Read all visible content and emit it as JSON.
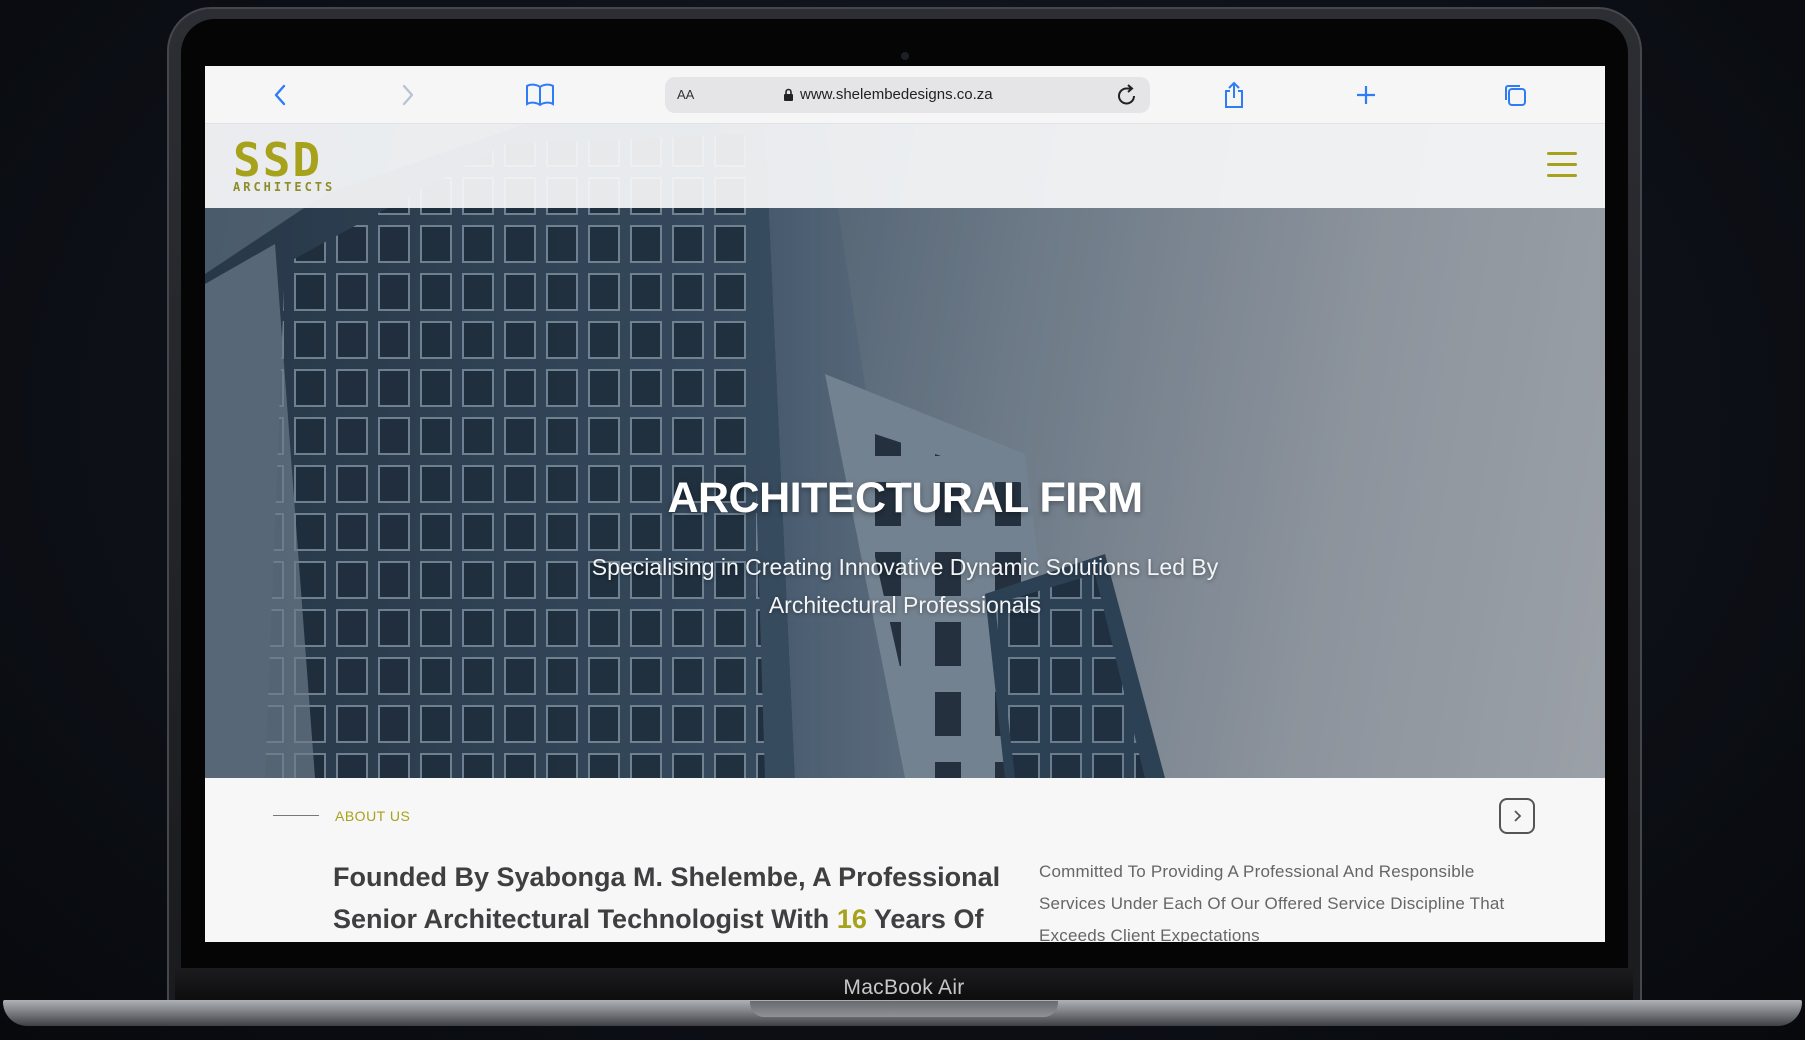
{
  "device": {
    "label": "MacBook Air"
  },
  "browser": {
    "text_size_label": "AA",
    "url": "www.shelembedesigns.co.za",
    "accent_color": "#2f7cf6"
  },
  "site": {
    "logo": {
      "letters": "SSD",
      "subtitle": "ARCHITECTS",
      "color": "#a7a21b"
    },
    "hero": {
      "title": "ARCHITECTURAL FIRM",
      "subtitle": "Specialising in Creating Innovative Dynamic Solutions Led By Architectural Professionals",
      "slides": 3,
      "active_slide": 1
    },
    "about": {
      "label": "ABOUT US",
      "heading_before": "Founded By Syabonga M. Shelembe, A Professional Senior Architectural Technologist With ",
      "heading_highlight": "16",
      "heading_after": " Years Of",
      "text": "Committed To Providing A Professional And Responsible Services Under Each Of Our Offered Service Discipline That Exceeds Client Expectations"
    }
  }
}
